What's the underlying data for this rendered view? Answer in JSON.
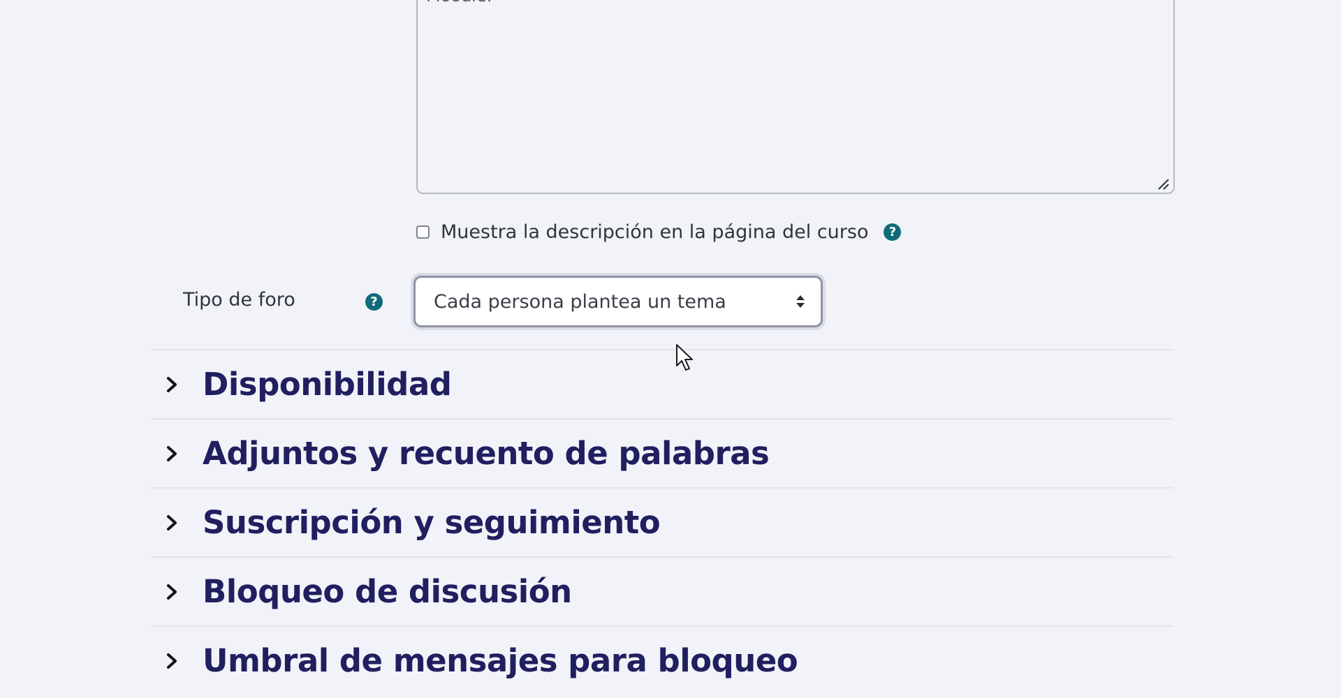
{
  "description_editor": {
    "visible_text": "Moodle."
  },
  "show_description": {
    "label": "Muestra la descripción en la página del curso",
    "checked": false,
    "help_icon": "question-circle-icon"
  },
  "forum_type": {
    "label": "Tipo de foro",
    "help_icon": "question-circle-icon",
    "selected_value": "Cada persona plantea un tema"
  },
  "sections": [
    {
      "title": "Disponibilidad",
      "icon": "chevron-right-icon"
    },
    {
      "title": "Adjuntos y recuento de palabras",
      "icon": "chevron-right-icon"
    },
    {
      "title": "Suscripción y seguimiento",
      "icon": "chevron-right-icon"
    },
    {
      "title": "Bloqueo de discusión",
      "icon": "chevron-right-icon"
    },
    {
      "title": "Umbral de mensajes para bloqueo",
      "icon": "chevron-right-icon"
    }
  ],
  "colors": {
    "background": "#f1f3f9",
    "section_title": "#201f5f",
    "help_icon": "#0f6b7a"
  }
}
